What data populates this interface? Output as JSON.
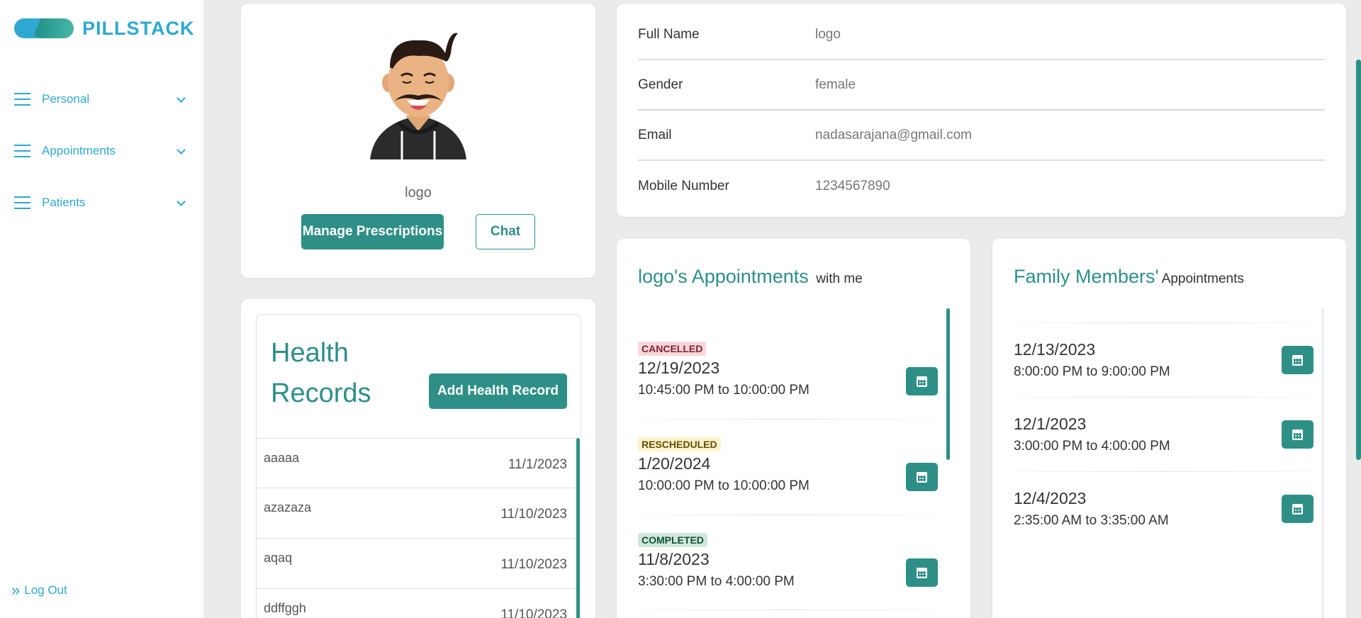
{
  "brand": {
    "name": "PILLSTACK"
  },
  "sidebar": {
    "items": [
      {
        "label": "Personal"
      },
      {
        "label": "Appointments"
      },
      {
        "label": "Patients"
      }
    ],
    "logout": "Log Out"
  },
  "profile": {
    "name": "logo",
    "manage_label": "Manage Prescriptions",
    "chat_label": "Chat"
  },
  "info": {
    "rows": [
      {
        "key": "Full Name",
        "value": "logo"
      },
      {
        "key": "Gender",
        "value": "female"
      },
      {
        "key": "Email",
        "value": "nadasarajana@gmail.com"
      },
      {
        "key": "Mobile Number",
        "value": "1234567890"
      }
    ]
  },
  "health": {
    "title_line1": "Health",
    "title_line2": "Records",
    "add_label": "Add Health Record",
    "records": [
      {
        "name": "aaaaa",
        "date": "11/1/2023"
      },
      {
        "name": "azazaza",
        "date": "11/10/2023"
      },
      {
        "name": "aqaq",
        "date": "11/10/2023"
      },
      {
        "name": "ddffggh",
        "date": "11/10/2023"
      }
    ]
  },
  "my_appts": {
    "title": "logo's Appointments",
    "subtitle": "with me",
    "items": [
      {
        "status": "CANCELLED",
        "date": "12/19/2023",
        "time": "10:45:00 PM to 10:00:00 PM"
      },
      {
        "status": "RESCHEDULED",
        "date": "1/20/2024",
        "time": "10:00:00 PM to 10:00:00 PM"
      },
      {
        "status": "COMPLETED",
        "date": "11/8/2023",
        "time": "3:30:00 PM to 4:00:00 PM"
      }
    ]
  },
  "family_appts": {
    "title": "Family Members'",
    "subtitle": "Appointments",
    "items": [
      {
        "date": "12/13/2023",
        "time": "8:00:00 PM to 9:00:00 PM"
      },
      {
        "date": "12/1/2023",
        "time": "3:00:00 PM to 4:00:00 PM"
      },
      {
        "date": "12/4/2023",
        "time": "2:35:00 AM to 3:35:00 AM"
      }
    ]
  },
  "colors": {
    "accent": "#2e8f87",
    "brand": "#2fa8d1",
    "background": "#ebebeb"
  }
}
